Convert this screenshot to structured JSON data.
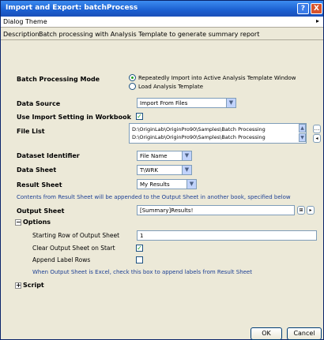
{
  "window": {
    "title": "Import and Export: batchProcess",
    "help_label": "?",
    "close_label": "X"
  },
  "theme": {
    "label": "Dialog Theme",
    "arrow": "▸"
  },
  "description": {
    "key": "Description",
    "value": "Batch processing with Analysis Template to generate summary report"
  },
  "mode": {
    "label": "Batch Processing Mode",
    "options": [
      "Repeatedly Import into Active Analysis Template Window",
      "Load Analysis Template"
    ],
    "selected_index": 0
  },
  "data_source": {
    "label": "Data Source",
    "value": "Import From Files"
  },
  "use_import": {
    "label": "Use Import Setting in Workbook",
    "checked": true
  },
  "file_list": {
    "label": "File List",
    "lines": [
      "D:\\OriginLab\\OriginPro90\\Samples\\Batch Processing",
      "D:\\OriginLab\\OriginPro90\\Samples\\Batch Processing"
    ]
  },
  "dataset_identifier": {
    "label": "Dataset Identifier",
    "value": "File Name"
  },
  "data_sheet": {
    "label": "Data Sheet",
    "value": "T\\WRK"
  },
  "result_sheet": {
    "label": "Result Sheet",
    "value": "My Results"
  },
  "note1": "Contents from Result Sheet will be appended to the Output Sheet in another book, specified below",
  "output_sheet": {
    "label": "Output Sheet",
    "value": "[Summary]Results!"
  },
  "options": {
    "label": "Options",
    "toggle": "−",
    "starting_row": {
      "label": "Starting Row of Output Sheet",
      "value": "1"
    },
    "clear_output": {
      "label": "Clear Output Sheet on Start",
      "checked": true
    },
    "append_label": {
      "label": "Append Label Rows",
      "checked": false
    }
  },
  "note2": "When Output Sheet is Excel, check this box to append labels from Result Sheet",
  "script": {
    "label": "Script",
    "toggle": "+"
  },
  "buttons": {
    "ok": "OK",
    "cancel": "Cancel"
  }
}
